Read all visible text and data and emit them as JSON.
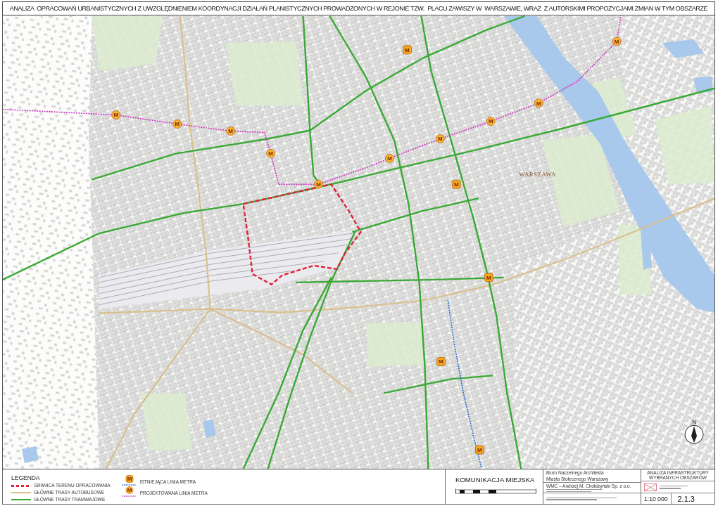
{
  "title": "ANALIZA  OPRACOWAŃ URBANISTYCZNYCH Z UWZGLĘDNIENIEM KOORDYNACJI DZIAŁAŃ PLANISTYCZNYCH PROWADZONYCH W REJONIE TZW.  PLACU ZAWISZY W  WARSZAWIE, WRAZ  Z AUTORSKIMI PROPOZYCJAMI ZMIAN W TYM OBSZARZE",
  "map": {
    "place_label": "WARSZAWA",
    "north_arrow": {
      "label": "N"
    },
    "metro_stations": [
      {
        "kind": "projected",
        "label": "M"
      },
      {
        "kind": "existing",
        "label": "M"
      },
      {
        "kind": "projected",
        "label": "M"
      },
      {
        "kind": "projected",
        "label": "M"
      },
      {
        "kind": "projected",
        "label": "M"
      },
      {
        "kind": "projected",
        "label": "M"
      },
      {
        "kind": "projected",
        "label": "M"
      },
      {
        "kind": "projected",
        "label": "M"
      },
      {
        "kind": "projected",
        "label": "M"
      },
      {
        "kind": "projected",
        "label": "M"
      },
      {
        "kind": "projected",
        "label": "M"
      },
      {
        "kind": "existing",
        "label": "M"
      },
      {
        "kind": "existing",
        "label": "M"
      },
      {
        "kind": "existing",
        "label": "M"
      },
      {
        "kind": "existing",
        "label": "M"
      }
    ]
  },
  "legend": {
    "title": "LEGENDA",
    "items": [
      {
        "kind": "boundary",
        "label": "GRANICA TERENU OPRACOWANIA"
      },
      {
        "kind": "bus",
        "label": "GŁÓWNE TRASY AUTOBUSOWE"
      },
      {
        "kind": "tram",
        "label": "GŁÓWNE TRASY TRAMWAJOWE"
      },
      {
        "kind": "metro_existing",
        "symbol": "M",
        "label": "ISTNIEJĄCA LINIA METRA"
      },
      {
        "kind": "metro_projected",
        "symbol": "M",
        "label": "PROJEKTOWANA LINIA METRA"
      }
    ]
  },
  "title_block": {
    "sheet_title": "KOMUNIKACJA MIEJSKA",
    "client_lines": [
      "Biuro Naczelnego Architekta",
      "Miasta Stołecznego Warszawy"
    ],
    "author_line": "WMC – Andrzej M. Chołdzyński Sp. z o.o.",
    "project": "ANALIZA INFRASTRUKTURY WYBRANYCH OBSZARÓW",
    "scale": "1:10 000",
    "sheet_number": "2.1.3"
  }
}
